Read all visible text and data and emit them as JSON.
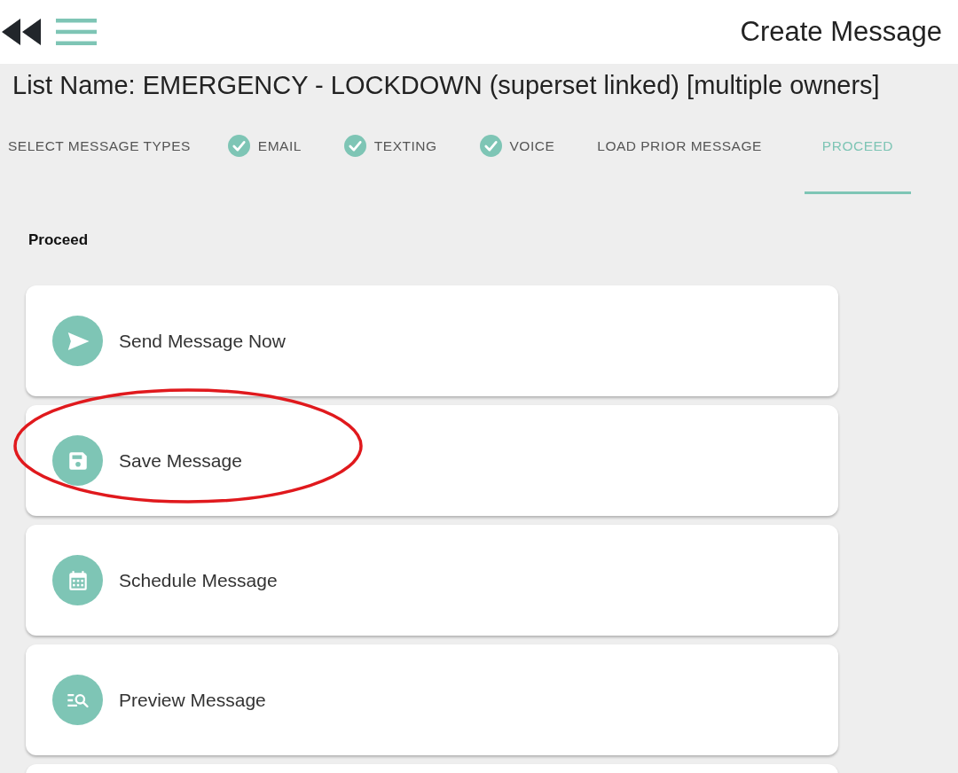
{
  "header": {
    "title": "Create Message"
  },
  "list_name": "List Name: EMERGENCY - LOCKDOWN (superset linked) [multiple owners]",
  "steps": [
    {
      "label": "SELECT MESSAGE TYPES",
      "checked": false,
      "selected": false
    },
    {
      "label": "EMAIL",
      "checked": true,
      "selected": false
    },
    {
      "label": "TEXTING",
      "checked": true,
      "selected": false
    },
    {
      "label": "VOICE",
      "checked": true,
      "selected": false
    },
    {
      "label": "LOAD PRIOR MESSAGE",
      "checked": false,
      "selected": false
    },
    {
      "label": "PROCEED",
      "checked": false,
      "selected": true
    }
  ],
  "section": {
    "heading": "Proceed"
  },
  "options": [
    {
      "kind": "send",
      "label": "Send Message Now",
      "highlighted": false
    },
    {
      "kind": "save",
      "label": "Save Message",
      "highlighted": true
    },
    {
      "kind": "schedule",
      "label": "Schedule Message",
      "highlighted": false
    },
    {
      "kind": "preview",
      "label": "Preview Message",
      "highlighted": false
    }
  ]
}
